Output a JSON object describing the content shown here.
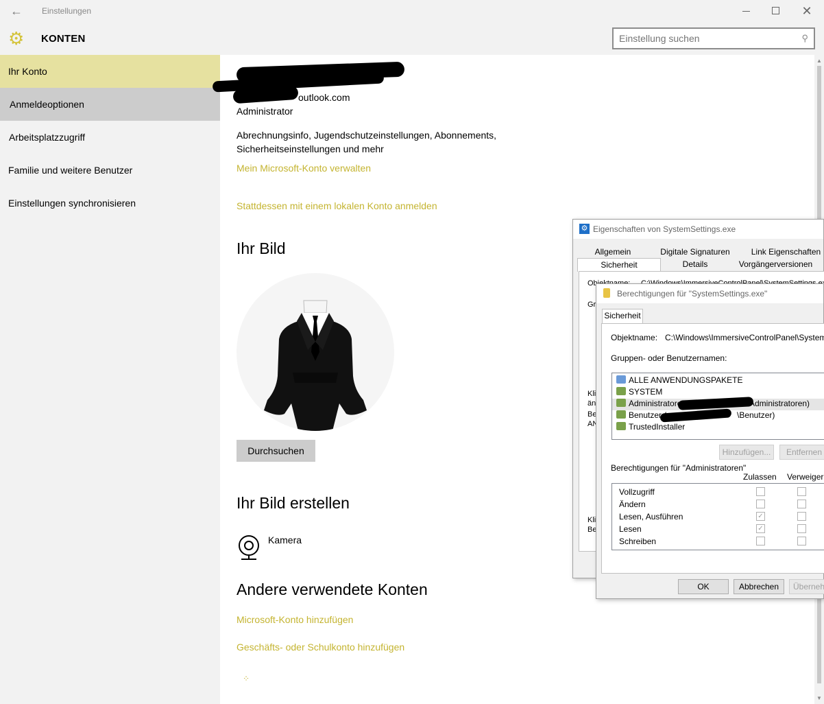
{
  "window": {
    "title": "Einstellungen",
    "back_glyph": "←",
    "minimize_label": "",
    "close_glyph": "✕"
  },
  "header": {
    "title": "KONTEN",
    "icon": "gear-icon",
    "search": {
      "placeholder": "Einstellung suchen",
      "value": ""
    }
  },
  "sidebar": {
    "items": [
      {
        "label": "Ihr Konto",
        "state": "selected"
      },
      {
        "label": "Anmeldeoptionen",
        "state": "hover"
      },
      {
        "label": "Arbeitsplatzzugriff",
        "state": ""
      },
      {
        "label": "Familie und weitere Benutzer",
        "state": ""
      },
      {
        "label": "Einstellungen synchronisieren",
        "state": ""
      }
    ]
  },
  "account": {
    "email_visible": "outlook.com",
    "role": "Administrator",
    "description_line1": "Abrechnungsinfo, Jugendschutzeinstellungen, Abonnements,",
    "description_line2": "Sicherheitseinstellungen und mehr",
    "manage_link": "Mein Microsoft-Konto verwalten",
    "local_link": "Stattdessen mit einem lokalen Konto anmelden"
  },
  "picture": {
    "heading": "Ihr Bild",
    "browse_button": "Durchsuchen"
  },
  "create_picture": {
    "heading": "Ihr Bild erstellen",
    "camera_label": "Kamera"
  },
  "other_accounts": {
    "heading": "Andere verwendete Konten",
    "add_microsoft": "Microsoft-Konto hinzufügen",
    "add_work": "Geschäfts- oder Schulkonto hinzufügen"
  },
  "properties_dialog": {
    "title": "Eigenschaften von SystemSettings.exe",
    "tabs_row1": [
      "Allgemein",
      "Digitale Signaturen",
      "Link Eigenschaften"
    ],
    "tabs_row2": [
      "Sicherheit",
      "Details",
      "Vorgängerversionen"
    ],
    "object_label_fragment": "Objektname:",
    "object_value_fragment": "C:\\Windows\\ImmersiveControlPanel\\SystemSettings.exe",
    "group_fragment": "Gr",
    "side_fragments": [
      "Klic",
      "änd",
      "Be",
      "AN"
    ],
    "bottom_fragments": [
      "Klic",
      "Be"
    ]
  },
  "permissions_dialog": {
    "title": "Berechtigungen für \"SystemSettings.exe\"",
    "tab": "Sicherheit",
    "object_label": "Objektname:",
    "object_value": "C:\\Windows\\ImmersiveControlPanel\\SystemSetti",
    "groups_label": "Gruppen- oder Benutzernamen:",
    "groups": [
      "ALLE ANWENDUNGSPAKETE",
      "SYSTEM",
      "Administratoren (",
      "Benutzer (",
      "TrustedInstaller"
    ],
    "groups_suffix": {
      "admin": "Administratoren)",
      "users": "\\Benutzer)"
    },
    "add_button": "Hinzufügen...",
    "remove_button": "Entfernen",
    "perm_label": "Berechtigungen für \"Administratoren\"",
    "allow_header": "Zulassen",
    "deny_header": "Verweigern",
    "permissions": [
      {
        "name": "Vollzugriff",
        "allow": false,
        "deny": false
      },
      {
        "name": "Ändern",
        "allow": false,
        "deny": false
      },
      {
        "name": "Lesen, Ausführen",
        "allow": true,
        "deny": false
      },
      {
        "name": "Lesen",
        "allow": true,
        "deny": false
      },
      {
        "name": "Schreiben",
        "allow": false,
        "deny": false
      }
    ],
    "ok_button": "OK",
    "cancel_button": "Abbrechen",
    "apply_button": "Übernehmen"
  },
  "colors": {
    "accent": "#c4b430",
    "selected_nav": "#e6e1a0",
    "hover_nav": "#cccccc",
    "chrome": "#f2f2f2"
  }
}
